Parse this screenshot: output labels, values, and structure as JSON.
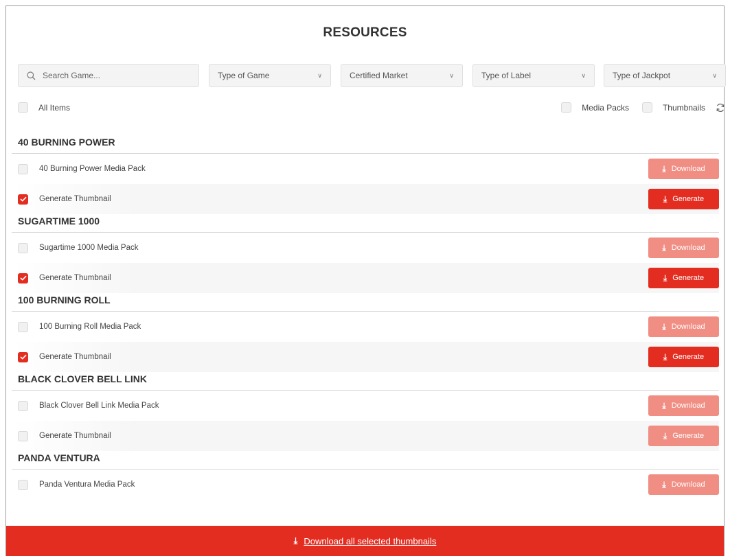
{
  "page": {
    "title": "RESOURCES"
  },
  "filters": {
    "search_placeholder": "Search Game...",
    "type_of_game": "Type of Game",
    "certified_market": "Certified Market",
    "type_of_label": "Type of Label",
    "type_of_jackpot": "Type of Jackpot"
  },
  "toggles": {
    "all_items": {
      "label": "All Items",
      "checked": false
    },
    "media_packs": {
      "label": "Media Packs",
      "checked": false
    },
    "thumbnails": {
      "label": "Thumbnails",
      "checked": false
    }
  },
  "groups": [
    {
      "name": "40 BURNING POWER",
      "rows": [
        {
          "label": "40 Burning Power Media Pack",
          "checked": false,
          "action": "Download",
          "active": false
        },
        {
          "label": "Generate Thumbnail",
          "checked": true,
          "action": "Generate",
          "active": true
        }
      ]
    },
    {
      "name": "SUGARTIME 1000",
      "rows": [
        {
          "label": "Sugartime 1000 Media Pack",
          "checked": false,
          "action": "Download",
          "active": false
        },
        {
          "label": "Generate Thumbnail",
          "checked": true,
          "action": "Generate",
          "active": true
        }
      ]
    },
    {
      "name": "100 BURNING ROLL",
      "rows": [
        {
          "label": "100 Burning Roll Media Pack",
          "checked": false,
          "action": "Download",
          "active": false
        },
        {
          "label": "Generate Thumbnail",
          "checked": true,
          "action": "Generate",
          "active": true
        }
      ]
    },
    {
      "name": "BLACK CLOVER BELL LINK",
      "rows": [
        {
          "label": "Black Clover Bell Link Media Pack",
          "checked": false,
          "action": "Download",
          "active": false
        },
        {
          "label": "Generate Thumbnail",
          "checked": false,
          "action": "Generate",
          "active": false
        }
      ]
    },
    {
      "name": "PANDA VENTURA",
      "rows": [
        {
          "label": "Panda Ventura Media Pack",
          "checked": false,
          "action": "Download",
          "active": false
        }
      ]
    }
  ],
  "footer": {
    "label": "Download all selected thumbnails"
  },
  "colors": {
    "accent": "#e42d21",
    "accent_disabled": "#f08e84"
  }
}
